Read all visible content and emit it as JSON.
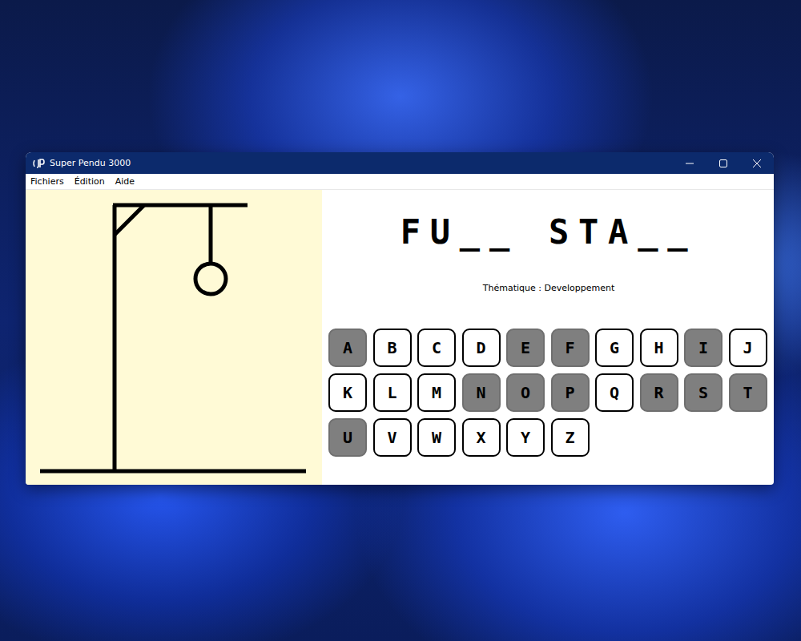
{
  "window": {
    "title": "Super Pendu 3000"
  },
  "menu": [
    "Fichiers",
    "Édition",
    "Aide"
  ],
  "hangman": {
    "parts": [
      {
        "kind": "head",
        "shown": true
      },
      {
        "kind": "body",
        "shown": false
      },
      {
        "kind": "left-arm",
        "shown": false
      },
      {
        "kind": "right-arm",
        "shown": false
      },
      {
        "kind": "left-leg",
        "shown": false
      },
      {
        "kind": "right-leg",
        "shown": false
      }
    ]
  },
  "word": "FU__ STA__",
  "theme": "Thématique : Developpement",
  "keys": [
    {
      "letter": "A",
      "used": true
    },
    {
      "letter": "B",
      "used": false
    },
    {
      "letter": "C",
      "used": false
    },
    {
      "letter": "D",
      "used": false
    },
    {
      "letter": "E",
      "used": true
    },
    {
      "letter": "F",
      "used": true
    },
    {
      "letter": "G",
      "used": false
    },
    {
      "letter": "H",
      "used": false
    },
    {
      "letter": "I",
      "used": true
    },
    {
      "letter": "J",
      "used": false
    },
    {
      "letter": "K",
      "used": false
    },
    {
      "letter": "L",
      "used": false
    },
    {
      "letter": "M",
      "used": false
    },
    {
      "letter": "N",
      "used": true
    },
    {
      "letter": "O",
      "used": true
    },
    {
      "letter": "P",
      "used": true
    },
    {
      "letter": "Q",
      "used": false
    },
    {
      "letter": "R",
      "used": true
    },
    {
      "letter": "S",
      "used": true
    },
    {
      "letter": "T",
      "used": true
    },
    {
      "letter": "U",
      "used": true
    },
    {
      "letter": "V",
      "used": false
    },
    {
      "letter": "W",
      "used": false
    },
    {
      "letter": "X",
      "used": false
    },
    {
      "letter": "Y",
      "used": false
    },
    {
      "letter": "Z",
      "used": false
    }
  ]
}
